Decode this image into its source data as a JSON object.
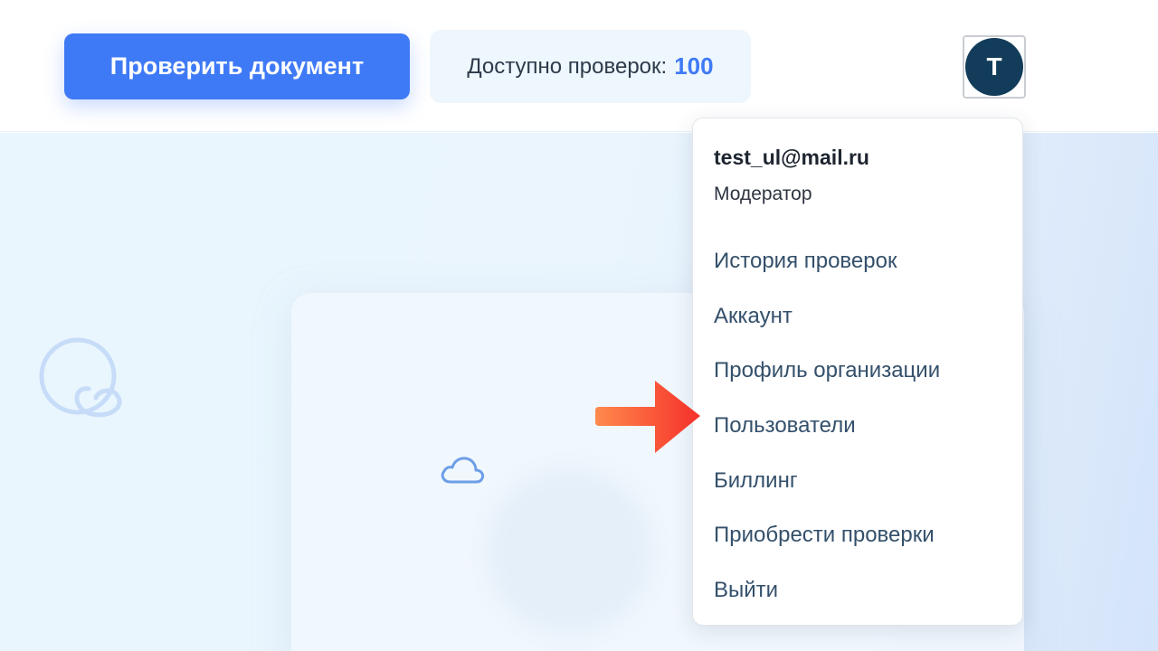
{
  "header": {
    "check_button": "Проверить документ",
    "quota_label": "Доступно проверок:",
    "quota_count": "100",
    "avatar_initial": "T"
  },
  "user_menu": {
    "email": "test_ul@mail.ru",
    "role": "Модератор",
    "items": [
      {
        "label": "История проверок"
      },
      {
        "label": "Аккаунт"
      },
      {
        "label": "Профиль организации"
      },
      {
        "label": "Пользователи"
      },
      {
        "label": "Биллинг"
      },
      {
        "label": "Приобрести проверки"
      },
      {
        "label": "Выйти"
      }
    ]
  },
  "colors": {
    "primary": "#3f7af6",
    "avatar_bg": "#123c5a",
    "menu_text": "#34506b",
    "arrow": "#f5452a"
  },
  "icons": {
    "avatar": "avatar-initial",
    "background_logo": "logo-decoration-icon",
    "card": "cloud-icon",
    "annotation": "arrow-right-icon"
  }
}
